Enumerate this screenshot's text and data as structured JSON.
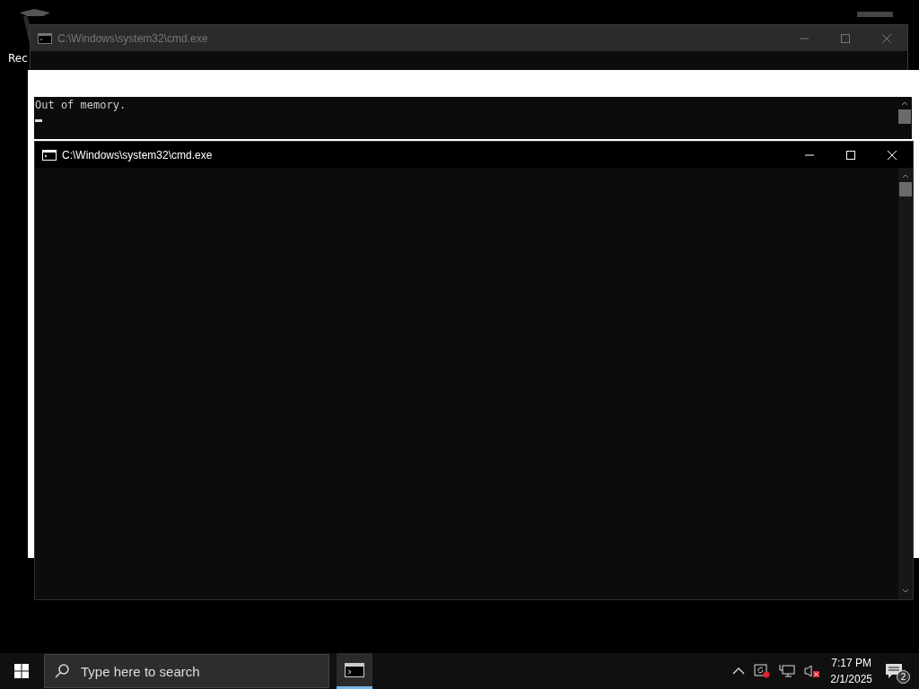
{
  "desktop": {
    "icons": [
      {
        "label": "Rec"
      }
    ]
  },
  "windows": [
    {
      "title": "C:\\Windows\\system32\\cmd.exe",
      "active": false
    },
    {
      "title": "C:\\Windows\\system32\\cmd.exe",
      "active": true
    }
  ],
  "glitch_console": {
    "lines": [
      "Out of memory."
    ]
  },
  "taskbar": {
    "search": {
      "placeholder": "Type here to search"
    },
    "apps": [
      {
        "kind": "console",
        "selected": true
      }
    ],
    "clock": {
      "time": "7:17 PM",
      "date": "2/1/2025"
    },
    "notifications": {
      "count": "2"
    }
  }
}
